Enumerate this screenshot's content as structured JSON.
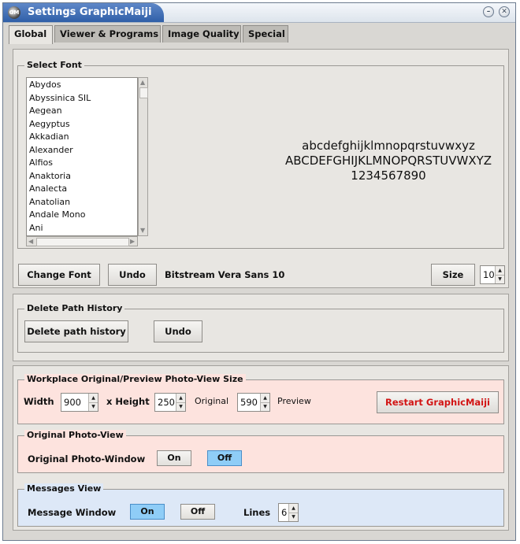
{
  "window": {
    "title": "Settings GraphicMaiji",
    "icon": "GM"
  },
  "tabs": [
    {
      "label": "Global"
    },
    {
      "label": "Viewer & Programs"
    },
    {
      "label": "Image Quality"
    },
    {
      "label": "Special"
    }
  ],
  "select_font": {
    "title": "Select Font",
    "fonts": [
      "Abydos",
      "Abyssinica SIL",
      "Aegean",
      "Aegyptus",
      "Akkadian",
      "Alexander",
      "Alfios",
      "Anaktoria",
      "Analecta",
      "Anatolian",
      "Andale Mono",
      "Ani"
    ],
    "preview": [
      "abcdefghijklmnopqrstuvwxyz",
      "ABCDEFGHIJKLMNOPQRSTUVWXYZ",
      "1234567890"
    ],
    "change_font": "Change Font",
    "undo": "Undo",
    "current_font": "Bitstream Vera Sans 10",
    "size_label": "Size",
    "size_value": "10"
  },
  "delete_path": {
    "title": "Delete Path History",
    "delete_button": "Delete path history",
    "undo": "Undo"
  },
  "workplace": {
    "title": "Workplace Original/Preview Photo-View Size",
    "width_label": "Width",
    "width_value": "900",
    "height_label": "x Height",
    "height_original_value": "250",
    "original_label": "Original",
    "height_preview_value": "590",
    "preview_label": "Preview",
    "restart_button": "Restart GraphicMaiji"
  },
  "original_view": {
    "title": "Original Photo-View",
    "label": "Original Photo-Window",
    "on": "On",
    "off": "Off",
    "state": "off"
  },
  "messages_view": {
    "title": "Messages View",
    "label": "Message Window",
    "on": "On",
    "off": "Off",
    "state": "on",
    "lines_label": "Lines",
    "lines_value": "6"
  },
  "colors": {
    "title_bar": "#2f5fa8",
    "workplace_bg": "#fde3de",
    "messages_bg": "#dde8f7",
    "toggle_on": "#8fcdf7",
    "restart_text": "#d21414"
  }
}
